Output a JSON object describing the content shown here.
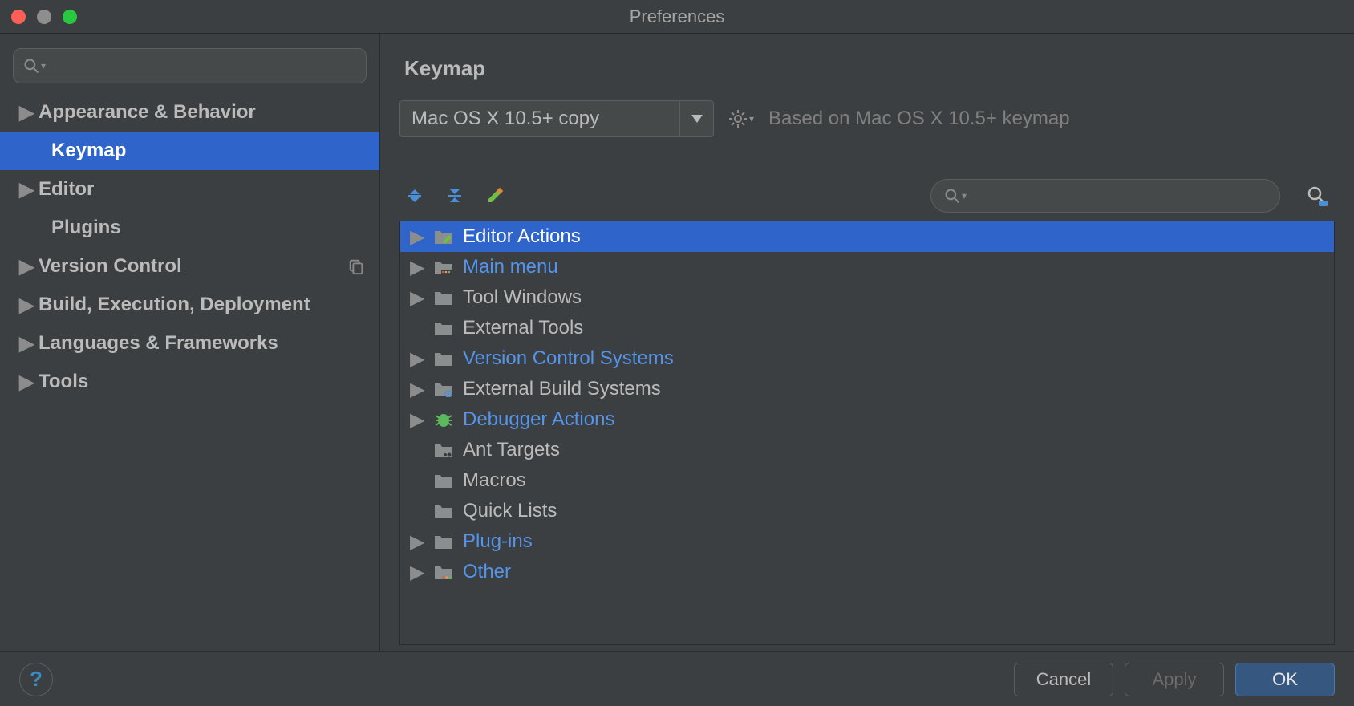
{
  "window": {
    "title": "Preferences"
  },
  "sidebar": {
    "items": [
      {
        "label": "Appearance & Behavior",
        "expandable": true,
        "selected": false
      },
      {
        "label": "Keymap",
        "expandable": false,
        "selected": true,
        "child": true
      },
      {
        "label": "Editor",
        "expandable": true,
        "selected": false
      },
      {
        "label": "Plugins",
        "expandable": false,
        "selected": false,
        "child": true
      },
      {
        "label": "Version Control",
        "expandable": true,
        "selected": false,
        "trailing_icon": "copy-icon"
      },
      {
        "label": "Build, Execution, Deployment",
        "expandable": true,
        "selected": false
      },
      {
        "label": "Languages & Frameworks",
        "expandable": true,
        "selected": false
      },
      {
        "label": "Tools",
        "expandable": true,
        "selected": false
      }
    ]
  },
  "content": {
    "title": "Keymap",
    "keymap_select": {
      "value": "Mac OS X 10.5+ copy"
    },
    "based_on": "Based on Mac OS X 10.5+ keymap",
    "tree": [
      {
        "label": "Editor Actions",
        "expandable": true,
        "selected": true,
        "highlight": false,
        "icon": "folder-edit-icon"
      },
      {
        "label": "Main menu",
        "expandable": true,
        "selected": false,
        "highlight": true,
        "icon": "folder-menu-icon"
      },
      {
        "label": "Tool Windows",
        "expandable": true,
        "selected": false,
        "highlight": false,
        "icon": "folder-icon"
      },
      {
        "label": "External Tools",
        "expandable": false,
        "selected": false,
        "highlight": false,
        "icon": "folder-icon"
      },
      {
        "label": "Version Control Systems",
        "expandable": true,
        "selected": false,
        "highlight": true,
        "icon": "folder-icon"
      },
      {
        "label": "External Build Systems",
        "expandable": true,
        "selected": false,
        "highlight": false,
        "icon": "folder-gear-icon"
      },
      {
        "label": "Debugger Actions",
        "expandable": true,
        "selected": false,
        "highlight": true,
        "icon": "bug-icon"
      },
      {
        "label": "Ant Targets",
        "expandable": false,
        "selected": false,
        "highlight": false,
        "icon": "folder-ant-icon"
      },
      {
        "label": "Macros",
        "expandable": false,
        "selected": false,
        "highlight": false,
        "icon": "folder-icon"
      },
      {
        "label": "Quick Lists",
        "expandable": false,
        "selected": false,
        "highlight": false,
        "icon": "folder-icon"
      },
      {
        "label": "Plug-ins",
        "expandable": true,
        "selected": false,
        "highlight": true,
        "icon": "folder-icon"
      },
      {
        "label": "Other",
        "expandable": true,
        "selected": false,
        "highlight": true,
        "icon": "folder-dots-icon"
      }
    ]
  },
  "footer": {
    "cancel": "Cancel",
    "apply": "Apply",
    "ok": "OK"
  }
}
